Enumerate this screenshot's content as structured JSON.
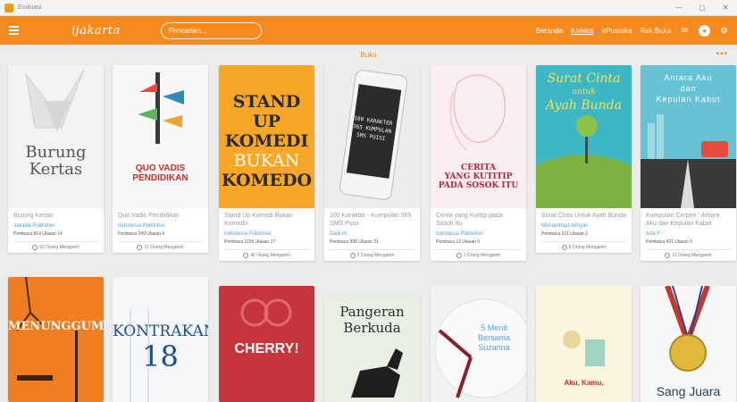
{
  "window": {
    "title": "Evaluasi",
    "controls": [
      "—",
      "▢",
      "✕"
    ]
  },
  "header": {
    "logo": "ijakarta",
    "search_placeholder": "Pencarian...",
    "nav": [
      "Beranda",
      "Koleksi",
      "ePustaka",
      "Rak Buku"
    ],
    "accent": "#f58a1f"
  },
  "section": {
    "title": "Buku"
  },
  "books": [
    {
      "title": "Burung Kertas",
      "author": "Jakarta Publisher",
      "stats": "Pembaca 814   Ulasan 14",
      "borrow": "22 Orang Mengantri",
      "cover_text": [
        "Burung",
        "Kertas"
      ]
    },
    {
      "title": "Quo Vadis Pendidikan",
      "author": "Indonesia Publisher",
      "stats": "Pembaca 249   Ulasan 4",
      "borrow": "11 Orang Mengantri",
      "cover_text": [
        "QUO VADIS",
        "PENDIDIKAN"
      ]
    },
    {
      "title": "Stand Up Komedi Bukan Komedo",
      "author": "Indonesia Publisher",
      "stats": "Pembaca 1126   Ulasan 17",
      "borrow": "46 Orang Mengantri",
      "cover_text": [
        "STAND UP",
        "KOMEDI",
        "BUKAN",
        "KOMEDO"
      ]
    },
    {
      "title": "100 Karakter - Kumpulan 365 SMS Puisi",
      "author": "Dadi Ar",
      "stats": "Pembaca 990   Ulasan 21",
      "borrow": "2 Orang Mengantri",
      "cover_text": [
        "100 KARAKTER",
        "365 KUMPULAN",
        "SMS PUISI"
      ]
    },
    {
      "title": "Cerita yang Kutitip pada Sosok Itu",
      "author": "Indonesia Publisher",
      "stats": "Pembaca 12   Ulasan 0",
      "borrow": "1 Orang Mengantri",
      "cover_text": [
        "CERITA",
        "YANG KUTITIP",
        "PADA SOSOK ITU"
      ]
    },
    {
      "title": "Surat Cinta Untuk Ayah Bunda",
      "author": "Muhammad Akhyar",
      "stats": "Pembaca 101   Ulasan 2",
      "borrow": "8 Orang Mengantri",
      "cover_text": [
        "Surat Cinta",
        "untuk",
        "Ayah Bunda"
      ]
    },
    {
      "title": "Kumpulan Cerpen : Antara Aku dan Kepulan Kabut",
      "author": "Ada F",
      "stats": "Pembaca 431   Ulasan 5",
      "borrow": "11 Orang Mengantri",
      "cover_text": [
        "Antara Aku",
        "dan",
        "Kepulan Kabut"
      ]
    },
    {
      "cover_text": [
        "MENUNGGUMU"
      ]
    },
    {
      "cover_text": [
        "KONTRAKAN",
        "18"
      ]
    },
    {
      "cover_text": [
        "CHERRY!"
      ]
    },
    {
      "cover_text": [
        "Pangeran",
        "Berkuda"
      ]
    },
    {
      "cover_text": [
        "5 Menit",
        "Bersama",
        "Suzanna"
      ]
    },
    {
      "cover_text": [
        "Aku, Kamu,"
      ]
    },
    {
      "cover_text": [
        "Sang Juara"
      ]
    }
  ]
}
